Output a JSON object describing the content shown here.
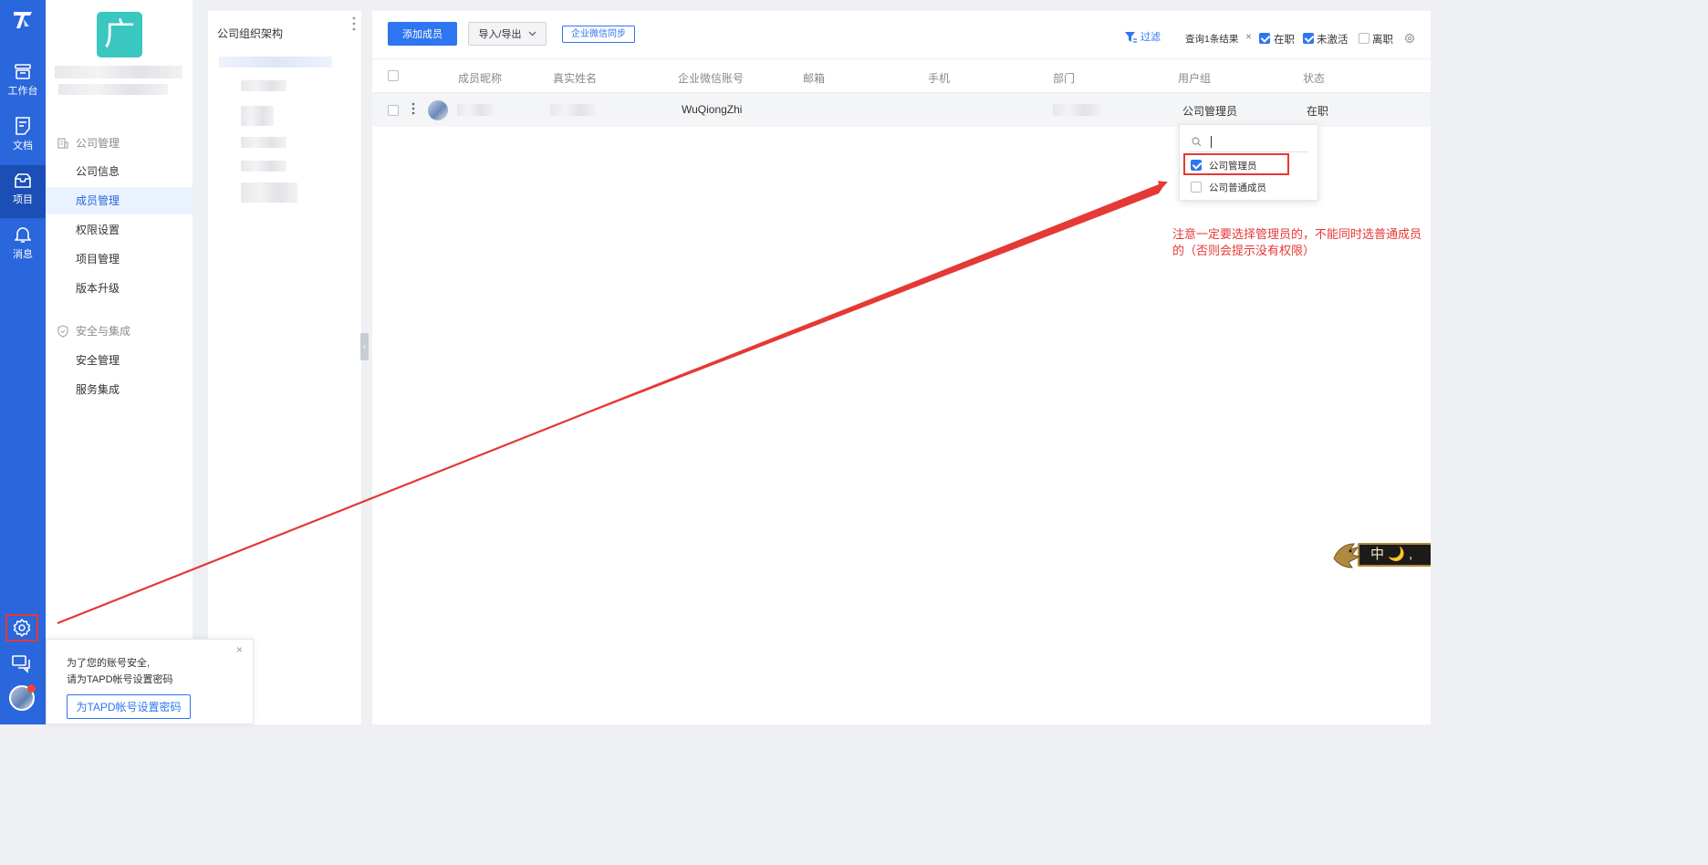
{
  "rail": {
    "items": [
      {
        "label": "工作台",
        "icon": "workbench-icon"
      },
      {
        "label": "文档",
        "icon": "document-icon"
      },
      {
        "label": "项目",
        "icon": "project-icon"
      },
      {
        "label": "消息",
        "icon": "bell-icon"
      }
    ]
  },
  "sidebar": {
    "logo_char": "广",
    "section_company": "公司管理",
    "company_items": [
      "公司信息",
      "成员管理",
      "权限设置",
      "项目管理",
      "版本升级"
    ],
    "section_security": "安全与集成",
    "security_items": [
      "安全管理",
      "服务集成"
    ]
  },
  "org": {
    "title": "公司组织架构"
  },
  "toolbar": {
    "add_member": "添加成员",
    "import_export": "导入/导出",
    "wechat_sync": "企业微信同步",
    "filter": "过滤",
    "result_text": "查询1条结果",
    "close": "×",
    "status_filters": [
      {
        "label": "在职",
        "checked": true
      },
      {
        "label": "未激活",
        "checked": true
      },
      {
        "label": "离职",
        "checked": false
      }
    ]
  },
  "table": {
    "columns": [
      "成员昵称",
      "真实姓名",
      "企业微信账号",
      "邮箱",
      "手机",
      "部门",
      "用户组",
      "状态"
    ],
    "rows": [
      {
        "nickname": "",
        "realname": "",
        "wechat": "WuQiongZhi",
        "email": "",
        "phone": "",
        "dept": "",
        "group": "公司管理员",
        "status": "在职"
      }
    ]
  },
  "group_dropdown": {
    "search_value": "",
    "options": [
      {
        "label": "公司管理员",
        "checked": true
      },
      {
        "label": "公司普通成员",
        "checked": false
      }
    ]
  },
  "annotation": {
    "note": "注意一定要选择管理员的，不能同时选普通成员的（否则会提示没有权限）",
    "color": "#e53935"
  },
  "security_popup": {
    "line1": "为了您的账号安全,",
    "line2": "请为TAPD帐号设置密码",
    "button": "为TAPD帐号设置密码",
    "close": "×"
  },
  "float_widget": {
    "text": "中 🌙 ,"
  },
  "colors": {
    "rail": "#2a66dc",
    "primary": "#2f74f0",
    "logo": "#39c7c0"
  }
}
